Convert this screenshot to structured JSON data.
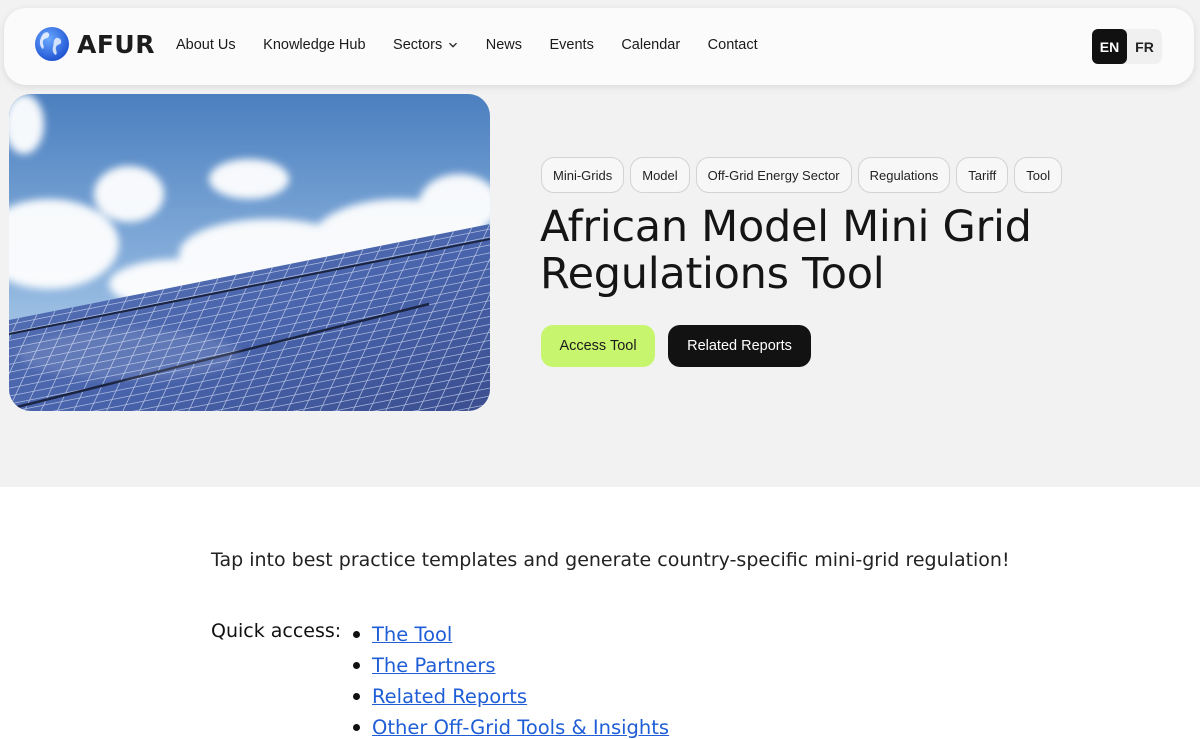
{
  "header": {
    "logo_text": "AFUR",
    "nav": [
      {
        "label": "About Us"
      },
      {
        "label": "Knowledge Hub"
      },
      {
        "label": "Sectors"
      },
      {
        "label": "News"
      },
      {
        "label": "Events"
      },
      {
        "label": "Calendar"
      },
      {
        "label": "Contact"
      }
    ],
    "lang": {
      "active": "EN",
      "other": "FR"
    }
  },
  "hero": {
    "tags": [
      "Mini-Grids",
      "Model",
      "Off-Grid Energy Sector",
      "Regulations",
      "Tariff",
      "Tool"
    ],
    "title": "African Model Mini Grid Regulations Tool",
    "buttons": {
      "access": "Access Tool",
      "related": "Related Reports"
    }
  },
  "content": {
    "intro": "Tap into best practice templates and generate country-specific mini-grid regulation!",
    "quick_access_label": "Quick access:",
    "links": [
      "The Tool",
      "The Partners",
      "Related Reports",
      "Other Off-Grid Tools & Insights"
    ]
  },
  "colors": {
    "accent_green": "#c8f56e",
    "link_blue": "#1f5ed6",
    "dark": "#121212"
  }
}
